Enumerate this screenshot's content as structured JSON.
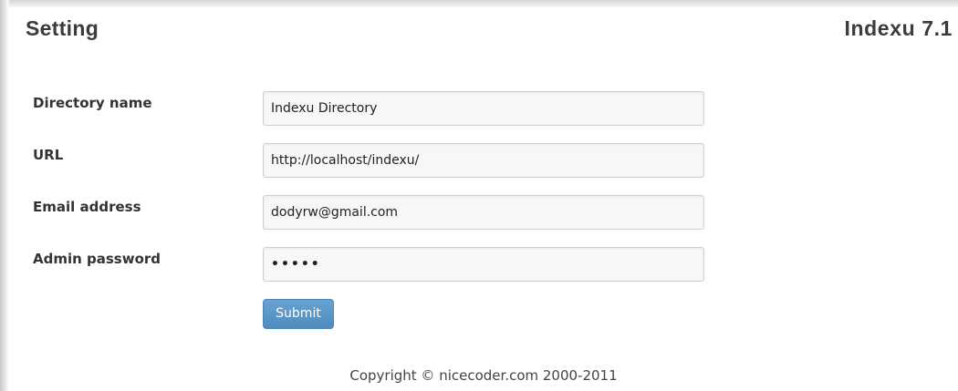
{
  "header": {
    "title": "Setting",
    "version": "Indexu 7.1"
  },
  "form": {
    "fields": [
      {
        "label": "Directory name",
        "value": "Indexu Directory"
      },
      {
        "label": "URL",
        "value": "http://localhost/indexu/"
      },
      {
        "label": "Email address",
        "value": "dodyrw@gmail.com"
      },
      {
        "label": "Admin password",
        "value": "•••••"
      }
    ],
    "submit_label": "Submit"
  },
  "footer": {
    "copyright": "Copyright © nicecoder.com 2000-2011"
  },
  "colors": {
    "button": "#5b97c8",
    "text": "#333333"
  }
}
